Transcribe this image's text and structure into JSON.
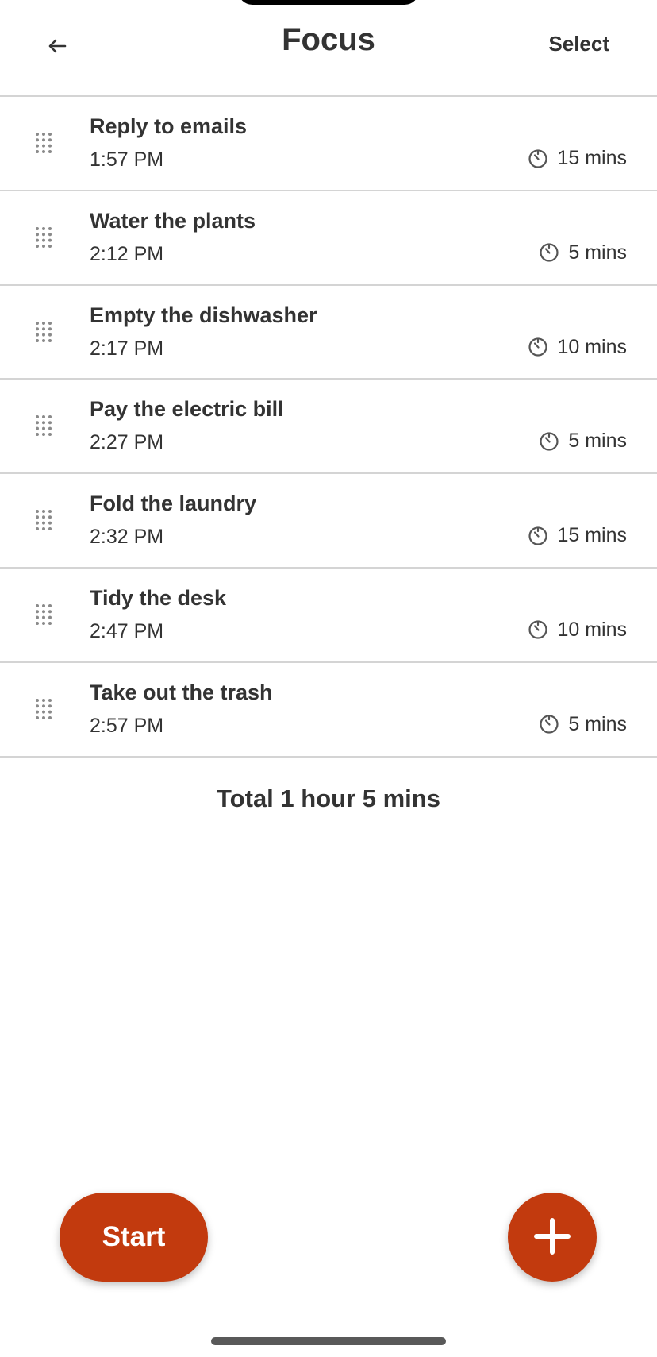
{
  "header": {
    "title": "Focus",
    "select_label": "Select",
    "back_icon": "arrow-left-icon"
  },
  "tasks": [
    {
      "name": "Reply to emails",
      "time": "1:57 PM",
      "duration": "15 mins"
    },
    {
      "name": "Water the plants",
      "time": "2:12 PM",
      "duration": "5 mins"
    },
    {
      "name": "Empty the dishwasher",
      "time": "2:17 PM",
      "duration": "10 mins"
    },
    {
      "name": "Pay the electric bill",
      "time": "2:27 PM",
      "duration": "5 mins"
    },
    {
      "name": "Fold the laundry",
      "time": "2:32 PM",
      "duration": "15 mins"
    },
    {
      "name": "Tidy the desk",
      "time": "2:47 PM",
      "duration": "10 mins"
    },
    {
      "name": "Take out the trash",
      "time": "2:57 PM",
      "duration": "5 mins"
    }
  ],
  "icons": {
    "drag": "drag-handle-icon",
    "duration": "timer-icon",
    "add": "plus-icon"
  },
  "summary": {
    "total": "Total 1 hour 5 mins"
  },
  "actions": {
    "start_label": "Start"
  },
  "colors": {
    "accent": "#c23a0e",
    "text": "#333333",
    "divider": "#d4d4d4"
  }
}
